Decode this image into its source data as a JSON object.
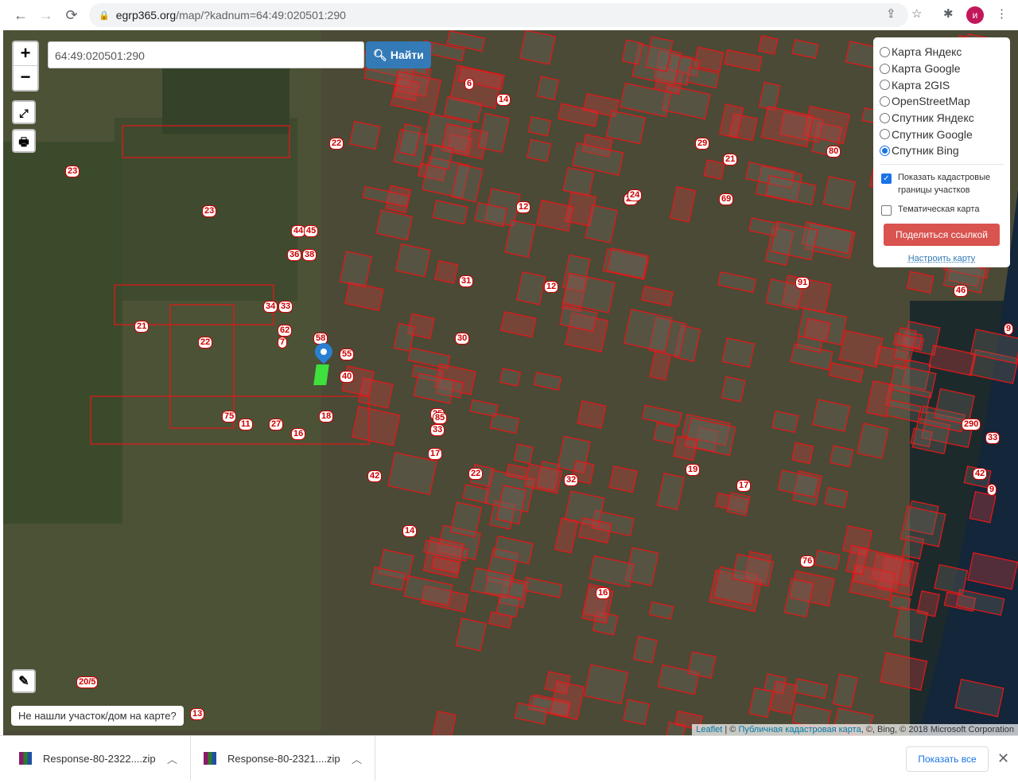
{
  "browser": {
    "url_host": "egrp365.org",
    "url_path": "/map/?kadnum=64:49:020501:290",
    "avatar_letter": "и"
  },
  "map": {
    "zoom_in": "+",
    "zoom_out": "−",
    "search_value": "64:49:020501:290",
    "find_label": "Найти",
    "layers": [
      "Карта Яндекс",
      "Карта Google",
      "Карта 2GIS",
      "OpenStreetMap",
      "Спутник Яндекс",
      "Спутник Google",
      "Спутник Bing"
    ],
    "selected_layer": 6,
    "show_borders_label": "Показать кадастровые границы участков",
    "show_borders_checked": true,
    "thematic_label": "Тематическая карта",
    "thematic_checked": false,
    "share_label": "Поделиться ссылкой",
    "configure_label": "Настроить карту",
    "not_found_label": "Не нашли участок/дом на карте?",
    "attribution": {
      "leaflet": "Leaflet",
      "sep": " | © ",
      "pkk": "Публичная кадастровая карта",
      "rest": ", ©, Bing, © 2018 Microsoft Corporation"
    },
    "parcel_labels": [
      "23",
      "23",
      "22",
      "21",
      "22",
      "22",
      "44",
      "45",
      "36",
      "38",
      "34",
      "33",
      "62",
      "7",
      "58",
      "55",
      "40",
      "75",
      "11",
      "27",
      "16",
      "18",
      "30",
      "6",
      "14",
      "29",
      "21",
      "80",
      "24",
      "12",
      "31",
      "17",
      "25",
      "33",
      "85",
      "42",
      "32",
      "19",
      "12",
      "16",
      "17",
      "5",
      "9",
      "290",
      "33",
      "42",
      "76",
      "9",
      "14",
      "20/5",
      "13",
      "24",
      "69",
      "91",
      "46"
    ]
  },
  "downloads": {
    "items": [
      "Response-80-2322....zip",
      "Response-80-2321....zip"
    ],
    "show_all": "Показать все"
  }
}
